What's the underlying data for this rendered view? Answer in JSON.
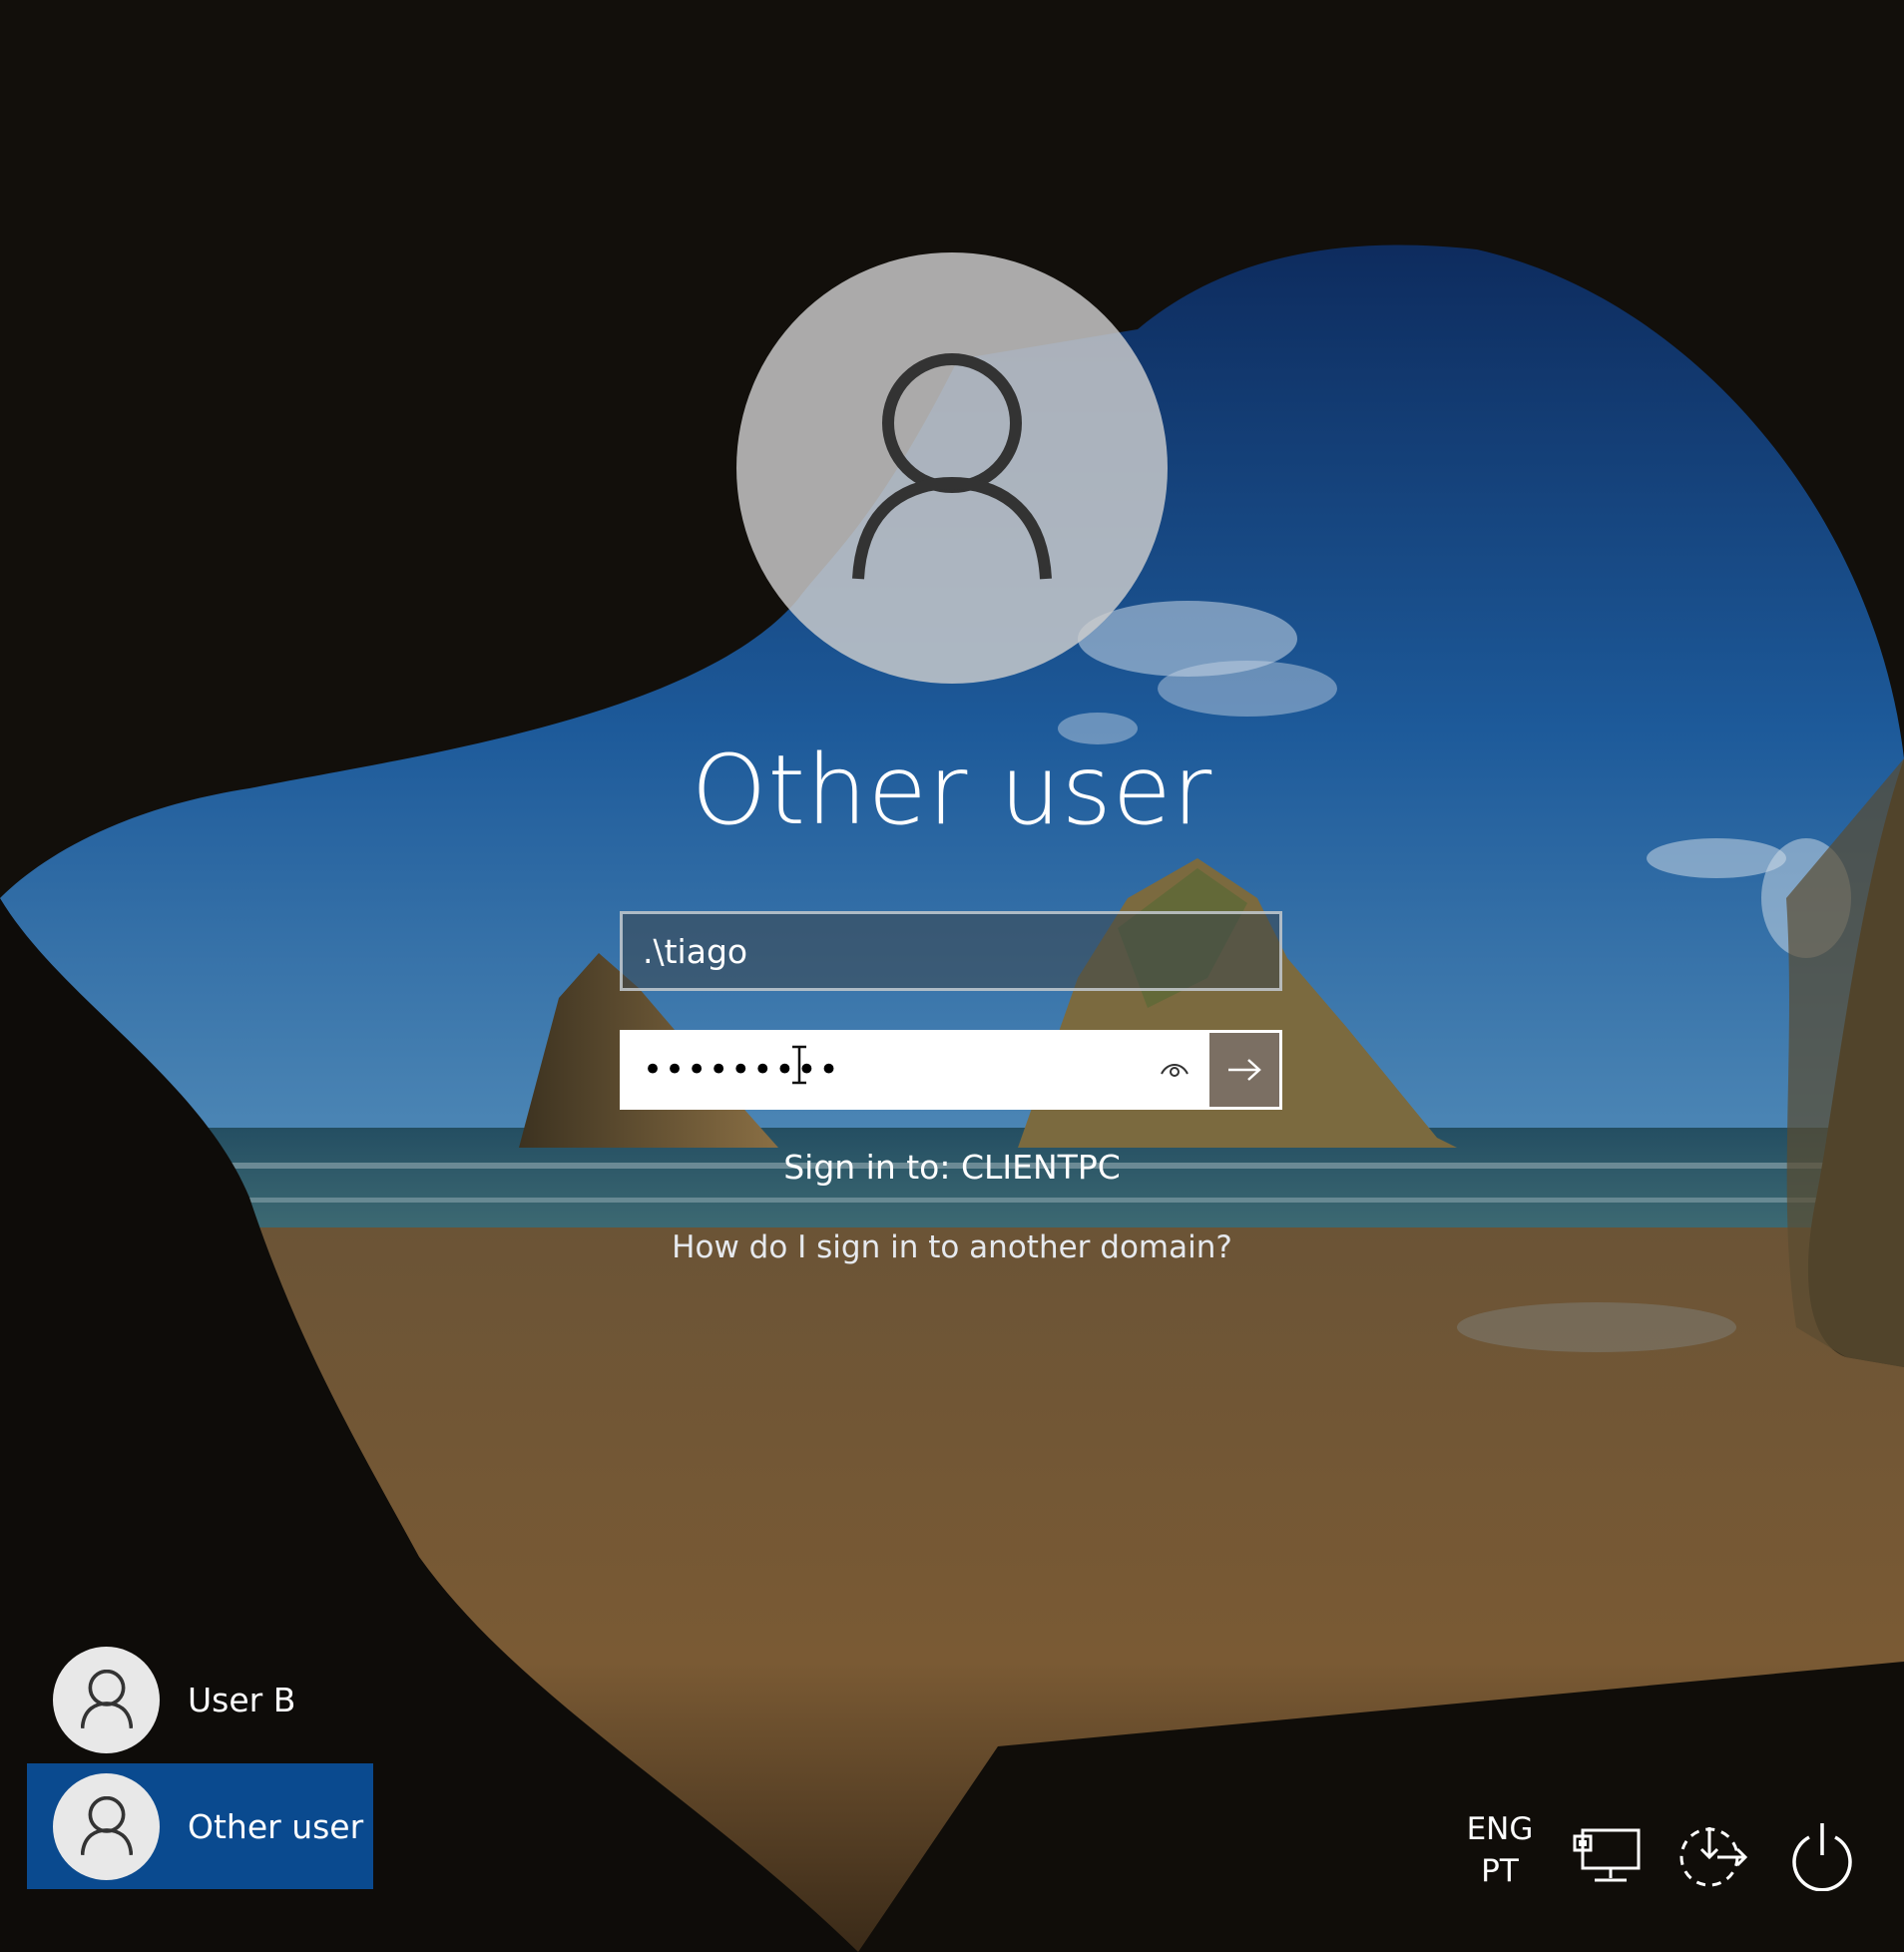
{
  "screen": {
    "title": "Other user"
  },
  "login": {
    "username_value": ".\\tiago",
    "password_masked": "•••••••••",
    "sign_in_to": "Sign in to: CLIENTPC",
    "another_domain_link": "How do I sign in to another domain?"
  },
  "user_list": [
    {
      "label": "User B",
      "selected": false
    },
    {
      "label": "Other user",
      "selected": true
    }
  ],
  "tray": {
    "lang_line1": "ENG",
    "lang_line2": "PT"
  },
  "icons": {
    "avatar": "user-icon",
    "reveal": "eye-icon",
    "submit": "arrow-right-icon",
    "network": "network-icon",
    "ease_of_access": "ease-of-access-icon",
    "power": "power-icon"
  },
  "colors": {
    "selected_tile": "#0a4a8f",
    "submit_button": "#7b6f63"
  }
}
